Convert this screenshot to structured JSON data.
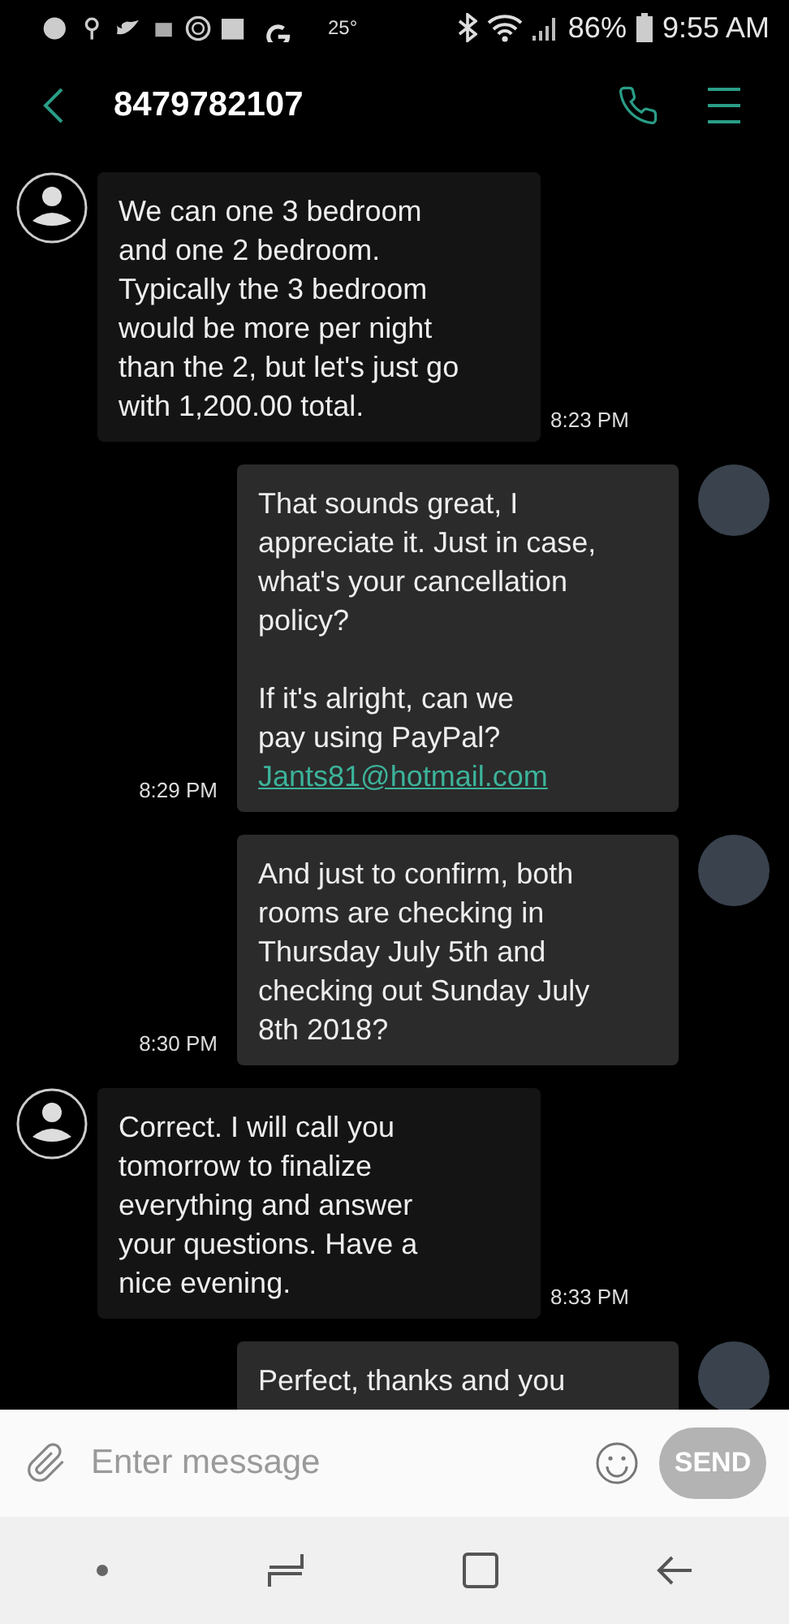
{
  "status_bar": {
    "temperature": "25°",
    "battery": "86%",
    "time": "9:55 AM"
  },
  "header": {
    "title": "8479782107"
  },
  "messages": [
    {
      "kind": "incoming",
      "text": "We can one 3 bedroom\nand one 2 bedroom.\nTypically the 3 bedroom\nwould be more per night\nthan the 2, but let's just go\nwith 1,200.00 total.",
      "time": "8:23 PM"
    },
    {
      "kind": "outgoing",
      "text": "That sounds great, I\nappreciate it. Just in case,\nwhat's your cancellation\npolicy?\n\nIf it's alright,  can we\npay using PayPal?",
      "link": "Jants81@hotmail.com",
      "time": "8:29 PM"
    },
    {
      "kind": "outgoing",
      "text": "And just to confirm, both\nrooms are checking in\nThursday July 5th and\nchecking out Sunday July\n8th 2018?",
      "time": "8:30 PM"
    },
    {
      "kind": "incoming",
      "text": "Correct. I will call you\ntomorrow to finalize\neverything and answer\nyour questions. Have a\nnice evening.",
      "time": "8:33 PM"
    },
    {
      "kind": "outgoing",
      "text": "Perfect,  thanks and you"
    }
  ],
  "composer": {
    "placeholder": "Enter message",
    "send_label": "SEND"
  }
}
